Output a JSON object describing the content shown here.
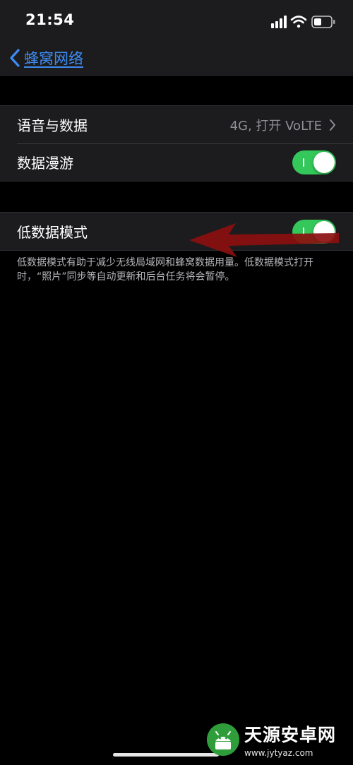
{
  "status_bar": {
    "time": "21:54",
    "icons": [
      "signal-icon",
      "wifi-icon",
      "battery-icon"
    ]
  },
  "nav": {
    "back_label": "蜂窝网络",
    "back_icon": "chevron-left-icon"
  },
  "section1": {
    "rows": [
      {
        "label": "语音与数据",
        "detail": "4G, 打开 VoLTE",
        "icon": "chevron-right-icon"
      },
      {
        "label": "数据漫游",
        "toggle_on": true
      }
    ]
  },
  "section2": {
    "rows": [
      {
        "label": "低数据模式",
        "toggle_on": true
      }
    ],
    "footer": "低数据模式有助于减少无线局域网和蜂窝数据用量。低数据模式打开时，“照片”同步等自动更新和后台任务将会暂停。"
  },
  "annotation": {
    "icon": "arrow-left-icon",
    "color": "#8b0f0f"
  },
  "watermark": {
    "title": "天源安卓网",
    "url": "www.jytyaz.com"
  },
  "colors": {
    "accent": "#3d8bf0",
    "toggle_on": "#34c759",
    "background": "#000000",
    "cell": "#1c1c1e"
  }
}
